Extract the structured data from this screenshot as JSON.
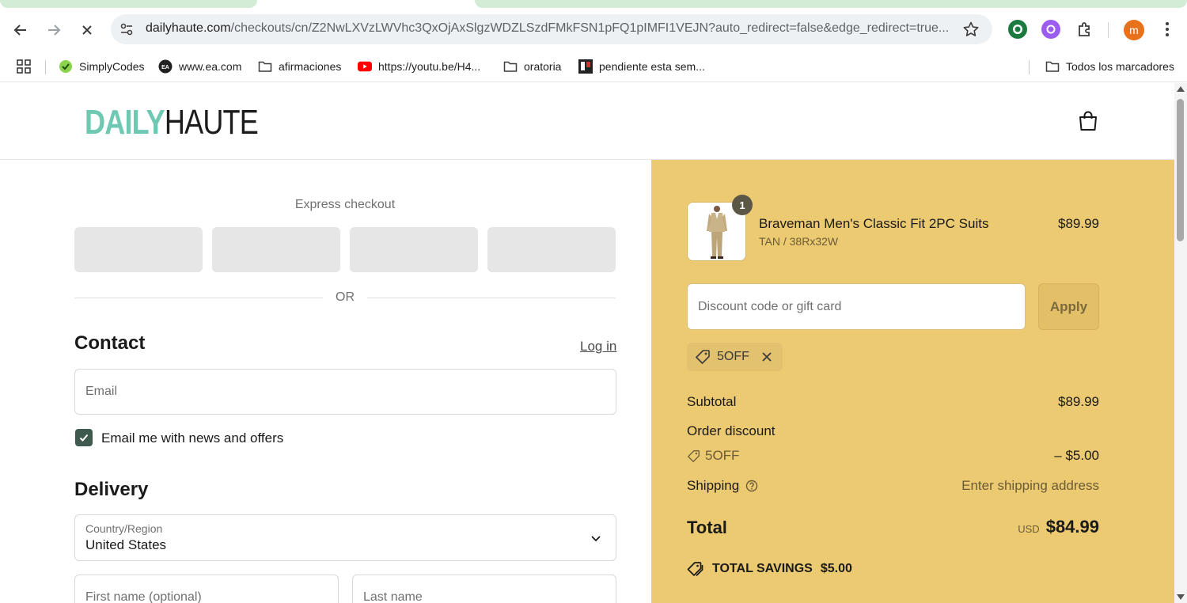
{
  "browser": {
    "url_host": "dailyhaute.com",
    "url_path": "/checkouts/cn/Z2NwLXVzLWVhc3QxOjAxSlgzWDZLSzdFMkFSN1pFQ1pIMFI1VEJN?auto_redirect=false&edge_redirect=true...",
    "profile_initial": "m",
    "bookmarks": [
      {
        "label": "SimplyCodes",
        "icon": "simplycodes-icon"
      },
      {
        "label": "www.ea.com",
        "icon": "ea-icon"
      },
      {
        "label": "afirmaciones",
        "icon": "folder-icon"
      },
      {
        "label": "https://youtu.be/H4...",
        "icon": "youtube-icon"
      },
      {
        "label": "oratoria",
        "icon": "folder-icon"
      },
      {
        "label": "pendiente esta sem...",
        "icon": "trello-icon"
      }
    ],
    "all_bookmarks_label": "Todos los marcadores"
  },
  "header": {
    "logo_part1": "DAILY",
    "logo_part2": "HAUTE"
  },
  "checkout": {
    "express_title": "Express checkout",
    "or_label": "OR",
    "contact_heading": "Contact",
    "login_label": "Log in",
    "email_placeholder": "Email",
    "news_label": "Email me with news and offers",
    "news_checked": true,
    "delivery_heading": "Delivery",
    "country_label": "Country/Region",
    "country_value": "United States",
    "first_name_placeholder": "First name (optional)",
    "last_name_placeholder": "Last name"
  },
  "summary": {
    "product_name": "Braveman Men's Classic Fit 2PC Suits",
    "product_variant": "TAN / 38Rx32W",
    "product_price": "$89.99",
    "quantity": "1",
    "discount_placeholder": "Discount code or gift card",
    "apply_label": "Apply",
    "applied_code": "5OFF",
    "subtotal_label": "Subtotal",
    "subtotal_value": "$89.99",
    "order_discount_label": "Order discount",
    "discount_code": "5OFF",
    "discount_value": "– $5.00",
    "shipping_label": "Shipping",
    "shipping_value": "Enter shipping address",
    "total_label": "Total",
    "currency": "USD",
    "total_value": "$84.99",
    "savings_label": "TOTAL SAVINGS",
    "savings_value": "$5.00"
  },
  "colors": {
    "summary_bg": "#ecca72",
    "logo_accent": "#6fc9b2",
    "checkbox": "#3e5a4f"
  }
}
